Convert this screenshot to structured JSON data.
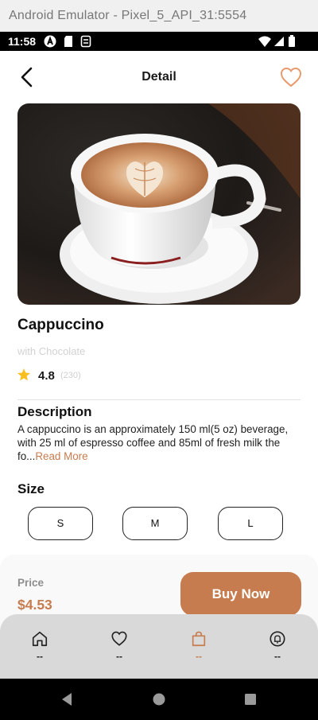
{
  "emulator": {
    "title": "Android Emulator - Pixel_5_API_31:5554"
  },
  "status_bar": {
    "time": "11:58"
  },
  "header": {
    "title": "Detail"
  },
  "product": {
    "name": "Cappuccino",
    "subtitle": "with Chocolate",
    "rating": "4.8",
    "rating_count": "(230)"
  },
  "description": {
    "title": "Description",
    "text": "A cappuccino is an approximately 150 ml(5 oz) beverage, with 25 ml of espresso coffee and 85ml of fresh milk the fo...",
    "read_more": "Read More"
  },
  "size": {
    "title": "Size",
    "options": [
      "S",
      "M",
      "L"
    ]
  },
  "purchase": {
    "price_label": "Price",
    "price": "$4.53",
    "buy_label": "Buy Now"
  },
  "bottom_nav": {
    "items": [
      {
        "icon": "home-icon",
        "label": "--"
      },
      {
        "icon": "heart-icon",
        "label": "--"
      },
      {
        "icon": "bag-icon",
        "label": "--"
      },
      {
        "icon": "notification-icon",
        "label": "--"
      }
    ],
    "active_index": 2
  },
  "colors": {
    "accent": "#C67C4E",
    "nav_background": "#D9D9D9",
    "star": "#FBBE21"
  }
}
